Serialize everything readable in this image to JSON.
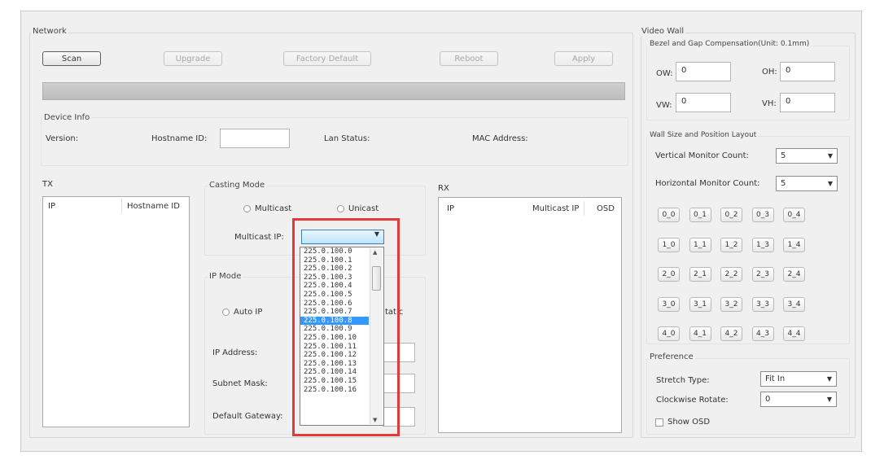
{
  "network": {
    "title": "Network",
    "buttons": {
      "scan": "Scan",
      "upgrade": "Upgrade",
      "factory_default": "Factory Default",
      "reboot": "Reboot",
      "apply": "Apply"
    }
  },
  "device_info": {
    "title": "Device Info",
    "version_label": "Version:",
    "hostname_label": "Hostname ID:",
    "hostname_value": "",
    "lan_status_label": "Lan Status:",
    "mac_label": "MAC Address:"
  },
  "tx": {
    "title": "TX",
    "columns": [
      "IP",
      "Hostname ID"
    ]
  },
  "casting_mode": {
    "title": "Casting Mode",
    "multicast_label": "Multicast",
    "unicast_label": "Unicast",
    "multicast_ip_label": "Multicast IP:",
    "multicast_ip_value": "",
    "options": [
      "225.0.100.0",
      "225.0.100.1",
      "225.0.100.2",
      "225.0.100.3",
      "225.0.100.4",
      "225.0.100.5",
      "225.0.100.6",
      "225.0.100.7",
      "225.0.100.8",
      "225.0.100.9",
      "225.0.100.10",
      "225.0.100.11",
      "225.0.100.12",
      "225.0.100.13",
      "225.0.100.14",
      "225.0.100.15",
      "225.0.100.16"
    ],
    "selected_index": 8
  },
  "ip_mode": {
    "title": "IP Mode",
    "auto_ip_label": "Auto IP",
    "static_partial": "tatic",
    "ip_address_label": "IP Address:",
    "subnet_mask_label": "Subnet Mask:",
    "default_gateway_label": "Default Gateway:"
  },
  "rx": {
    "title": "RX",
    "columns": [
      "IP",
      "Multicast IP",
      "OSD"
    ]
  },
  "video_wall": {
    "title": "Video Wall",
    "bezel_title": "Bezel and Gap Compensation(Unit: 0.1mm)",
    "ow_label": "OW:",
    "ow_value": "0",
    "oh_label": "OH:",
    "oh_value": "0",
    "vw_label": "VW:",
    "vw_value": "0",
    "vh_label": "VH:",
    "vh_value": "0",
    "layout_title": "Wall Size and Position Layout",
    "vertical_label": "Vertical Monitor Count:",
    "vertical_value": "5",
    "horizontal_label": "Horizontal Monitor Count:",
    "horizontal_value": "5",
    "grid": [
      [
        "0_0",
        "0_1",
        "0_2",
        "0_3",
        "0_4"
      ],
      [
        "1_0",
        "1_1",
        "1_2",
        "1_3",
        "1_4"
      ],
      [
        "2_0",
        "2_1",
        "2_2",
        "2_3",
        "2_4"
      ],
      [
        "3_0",
        "3_1",
        "3_2",
        "3_3",
        "3_4"
      ],
      [
        "4_0",
        "4_1",
        "4_2",
        "4_3",
        "4_4"
      ]
    ]
  },
  "preference": {
    "title": "Preference",
    "stretch_label": "Stretch Type:",
    "stretch_value": "Fit In",
    "rotate_label": "Clockwise Rotate:",
    "rotate_value": "0",
    "show_osd_label": "Show OSD"
  },
  "colors": {
    "highlight": "#e23a3a",
    "selection": "#3399ff"
  }
}
